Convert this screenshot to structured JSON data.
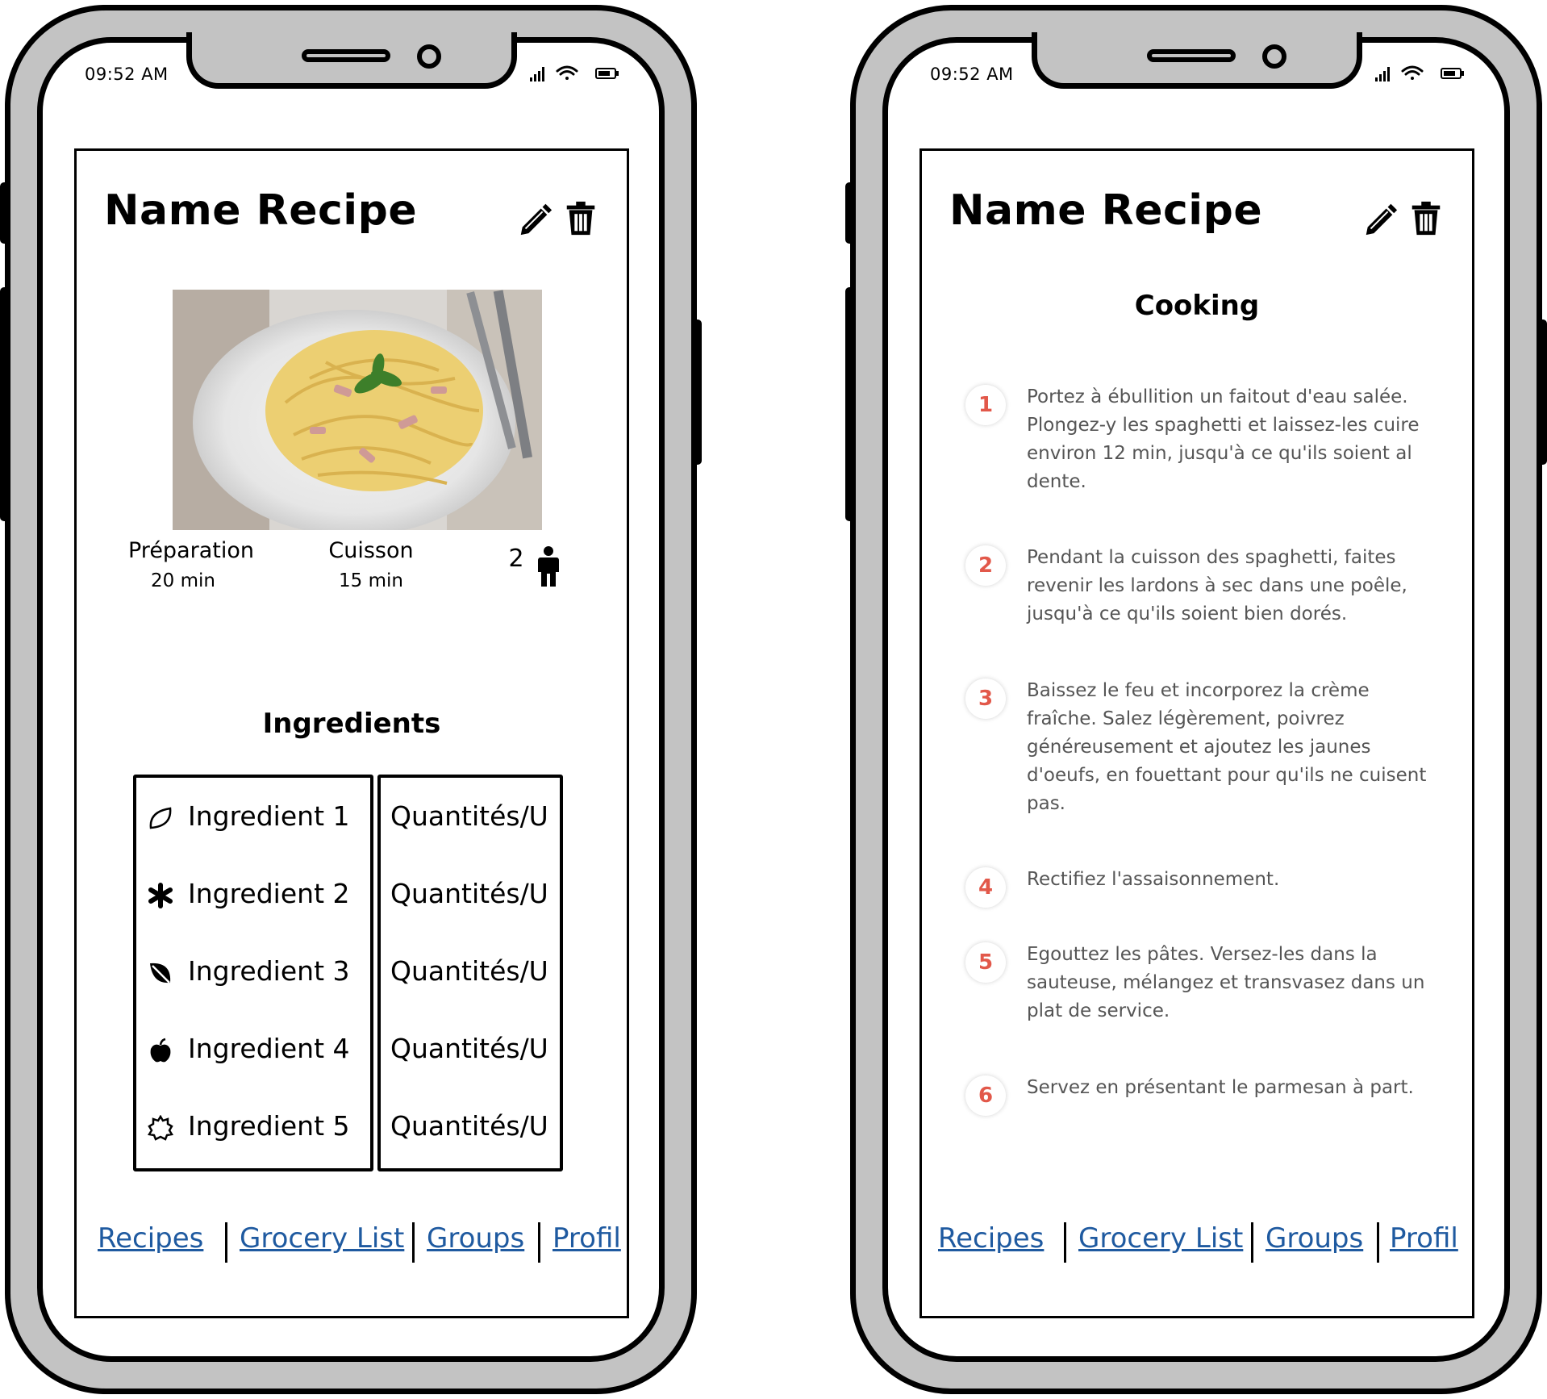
{
  "status_bar": {
    "time": "09:52 AM"
  },
  "screen_left": {
    "title": "Name Recipe",
    "meta": {
      "preparation_label": "Préparation",
      "preparation_value": "20 min",
      "cooking_label": "Cuisson",
      "cooking_value": "15 min",
      "servings": "2"
    },
    "ingredients_title": "Ingredients",
    "ingredients": [
      {
        "name": "Ingredient 1",
        "quantity": "Quantités/U",
        "icon": "leaf-outline-icon"
      },
      {
        "name": "Ingredient 2",
        "quantity": "Quantités/U",
        "icon": "asterisk-icon"
      },
      {
        "name": "Ingredient 3",
        "quantity": "Quantités/U",
        "icon": "leaf-icon"
      },
      {
        "name": "Ingredient 4",
        "quantity": "Quantités/U",
        "icon": "apple-icon"
      },
      {
        "name": "Ingredient 5",
        "quantity": "Quantités/U",
        "icon": "sun-outline-icon"
      }
    ]
  },
  "screen_right": {
    "title": "Name Recipe",
    "cooking_title": "Cooking",
    "steps": [
      {
        "number": "1",
        "text": "Portez à ébullition un faitout d'eau salée. Plongez-y les spaghetti et laissez-les cuire environ 12 min, jusqu'à ce qu'ils soient al dente."
      },
      {
        "number": "2",
        "text": "Pendant la cuisson des spaghetti, faites revenir les lardons à sec dans une poêle, jusqu'à ce qu'ils soient bien dorés."
      },
      {
        "number": "3",
        "text": "Baissez le feu et incorporez la crème fraîche. Salez légèrement, poivrez généreusement et ajoutez les jaunes d'oeufs, en fouettant pour qu'ils ne cuisent pas."
      },
      {
        "number": "4",
        "text": "Rectifiez l'assaisonnement."
      },
      {
        "number": "5",
        "text": "Egouttez les pâtes. Versez-les dans la sauteuse, mélangez et transvasez dans un plat de service."
      },
      {
        "number": "6",
        "text": "Servez en présentant le parmesan à part."
      }
    ]
  },
  "nav": {
    "recipes": "Recipes",
    "grocery_list": "Grocery List",
    "groups": "Groups",
    "profil": "Profil"
  },
  "colors": {
    "frame_gray": "#c3c3c3",
    "link_blue": "#1f5aa0",
    "step_number_red": "#e2584a"
  }
}
